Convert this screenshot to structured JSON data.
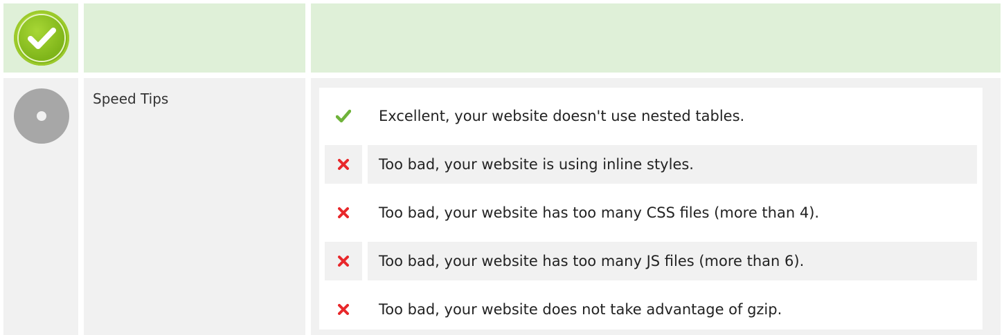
{
  "header": {
    "status_icon": "check-circle-icon",
    "accent_color": "#8cc21c",
    "row_color": "#dff0d8"
  },
  "section": {
    "status_icon": "neutral-dot-icon",
    "title": "Speed Tips",
    "tips": [
      {
        "status": "pass",
        "icon": "check-icon",
        "icon_color": "#6fb33a",
        "text": "Excellent, your website doesn't use nested tables."
      },
      {
        "status": "fail",
        "icon": "cross-icon",
        "icon_color": "#e8282b",
        "text": "Too bad, your website is using inline styles."
      },
      {
        "status": "fail",
        "icon": "cross-icon",
        "icon_color": "#e8282b",
        "text": "Too bad, your website has too many CSS files (more than 4)."
      },
      {
        "status": "fail",
        "icon": "cross-icon",
        "icon_color": "#e8282b",
        "text": "Too bad, your website has too many JS files (more than 6)."
      },
      {
        "status": "fail",
        "icon": "cross-icon",
        "icon_color": "#e8282b",
        "text": "Too bad, your website does not take advantage of gzip."
      }
    ]
  }
}
